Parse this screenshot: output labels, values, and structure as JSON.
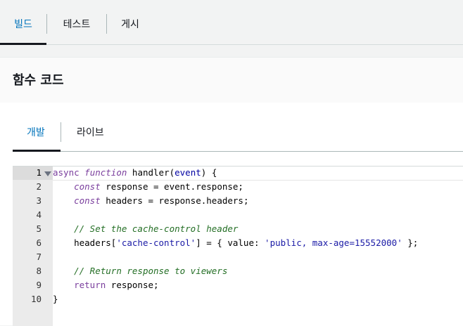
{
  "top_tabs": [
    {
      "label": "빌드",
      "active": true
    },
    {
      "label": "테스트",
      "active": false
    },
    {
      "label": "게시",
      "active": false
    }
  ],
  "panel": {
    "title": "함수 코드"
  },
  "sub_tabs": [
    {
      "label": "개발",
      "active": true
    },
    {
      "label": "라이브",
      "active": false
    }
  ],
  "editor": {
    "line_numbers": [
      "1",
      "2",
      "3",
      "4",
      "5",
      "6",
      "7",
      "8",
      "9",
      "10"
    ],
    "lines": [
      "async function handler(event) {",
      "    const response = event.response;",
      "    const headers = response.headers;",
      "",
      "    // Set the cache-control header",
      "    headers['cache-control'] = { value: 'public, max-age=15552000' };",
      "",
      "    // Return response to viewers",
      "    return response;",
      "}"
    ]
  },
  "colors": {
    "accent": "#0073bb",
    "keyword": "#7a3e9d",
    "comment": "#236e24",
    "string": "#1a1aa6"
  }
}
